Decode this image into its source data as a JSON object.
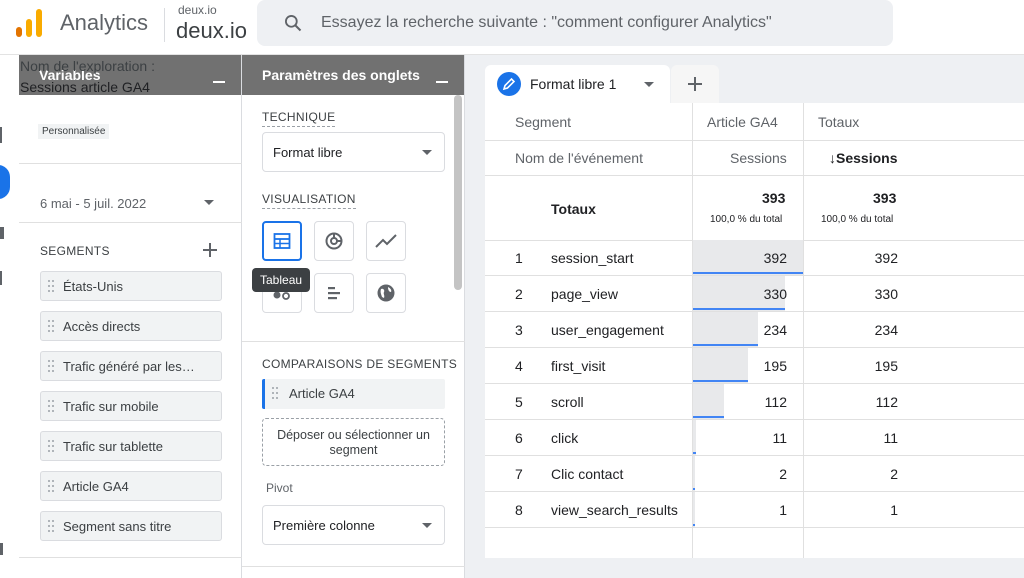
{
  "app": {
    "title": "Analytics",
    "account_small": "deux.io",
    "account_big": "deux.io",
    "brand_colors": [
      "#f9ab00",
      "#e37400"
    ]
  },
  "search": {
    "placeholder": "Essayez la recherche suivante : \"comment configurer Analytics\""
  },
  "variables_panel": {
    "header": "Variables",
    "exploration_label": "Nom de l'exploration :",
    "exploration_name": "Sessions article GA4",
    "date_badge": "Personnalisée",
    "date_range": "6 mai - 5 juil. 2022",
    "segments_title": "SEGMENTS",
    "segments": [
      "États-Unis",
      "Accès directs",
      "Trafic généré par les…",
      "Trafic sur mobile",
      "Trafic sur tablette",
      "Article GA4",
      "Segment sans titre"
    ]
  },
  "tab_settings": {
    "header": "Paramètres des onglets",
    "technique_label": "TECHNIQUE",
    "technique_value": "Format libre",
    "visualisation_label": "VISUALISATION",
    "visualisations": [
      "table-icon",
      "donut-chart-icon",
      "line-chart-icon",
      "scatter-icon",
      "bar-chart-icon",
      "geo-map-icon"
    ],
    "tooltip": "Tableau",
    "comparisons_label": "COMPARAISONS DE SEGMENTS",
    "comparison_segment": "Article GA4",
    "drop_hint": "Déposer ou sélectionner un segment",
    "pivot_label": "Pivot",
    "pivot_value": "Première colonne"
  },
  "canvas": {
    "tab_label": "Format libre 1",
    "accent": "#1a73e8"
  },
  "table": {
    "header_segment": "Segment",
    "header_col1": "Article GA4",
    "header_col2": "Totaux",
    "dimension_label": "Nom de l'événement",
    "metric_col1": "Sessions",
    "metric_col2": "↓Sessions",
    "totals_label": "Totaux",
    "totals_col1": "393",
    "totals_col2": "393",
    "totals_pct_col1": "100,0 % du total",
    "totals_pct_col2": "100,0 % du total",
    "rows": [
      {
        "idx": "1",
        "name": "session_start",
        "v1": "392",
        "v2": "392",
        "fraction": 0.9975
      },
      {
        "idx": "2",
        "name": "page_view",
        "v1": "330",
        "v2": "330",
        "fraction": 0.8397
      },
      {
        "idx": "3",
        "name": "user_engagement",
        "v1": "234",
        "v2": "234",
        "fraction": 0.5954
      },
      {
        "idx": "4",
        "name": "first_visit",
        "v1": "195",
        "v2": "195",
        "fraction": 0.4962
      },
      {
        "idx": "5",
        "name": "scroll",
        "v1": "112",
        "v2": "112",
        "fraction": 0.285
      },
      {
        "idx": "6",
        "name": "click",
        "v1": "11",
        "v2": "11",
        "fraction": 0.028
      },
      {
        "idx": "7",
        "name": "Clic contact",
        "v1": "2",
        "v2": "2",
        "fraction": 0.0051
      },
      {
        "idx": "8",
        "name": "view_search_results",
        "v1": "1",
        "v2": "1",
        "fraction": 0.0025
      }
    ]
  }
}
